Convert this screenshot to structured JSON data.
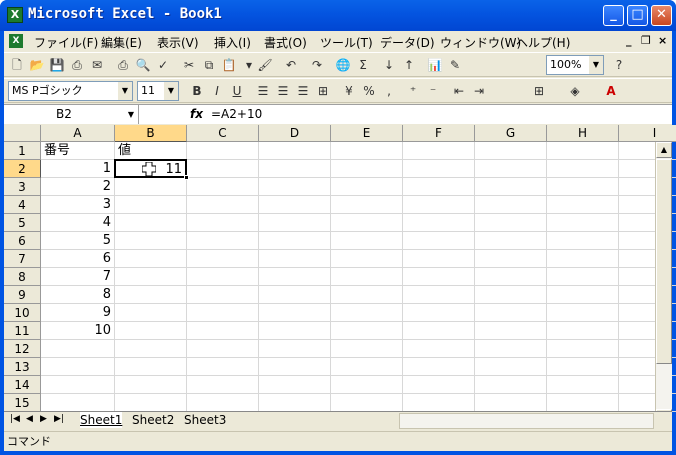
{
  "app": {
    "title": "Microsoft Excel - Book1",
    "icon_label": "X"
  },
  "window_buttons": {
    "minimize": "_",
    "maximize": "□",
    "close": "✕"
  },
  "menu": [
    {
      "label": "ファイル(F)"
    },
    {
      "label": "編集(E)"
    },
    {
      "label": "表示(V)"
    },
    {
      "label": "挿入(I)"
    },
    {
      "label": "書式(O)"
    },
    {
      "label": "ツール(T)"
    },
    {
      "label": "データ(D)"
    },
    {
      "label": "ウィンドウ(W)"
    },
    {
      "label": "ヘルプ(H)"
    }
  ],
  "mdi": {
    "minimize": "_",
    "restore": "❐",
    "close": "×"
  },
  "standard_toolbar": {
    "zoom": "100%"
  },
  "format_toolbar": {
    "font_name": "MS Pゴシック",
    "font_size": "11",
    "bold": "B",
    "italic": "I",
    "underline": "U",
    "percent": "%",
    "comma": ","
  },
  "formula_bar": {
    "name_box": "B2",
    "fx": "fx",
    "formula": "=A2+10"
  },
  "columns": [
    "A",
    "B",
    "C",
    "D",
    "E",
    "F",
    "G",
    "H",
    "I"
  ],
  "rows": [
    "1",
    "2",
    "3",
    "4",
    "5",
    "6",
    "7",
    "8",
    "9",
    "10",
    "11",
    "12",
    "13",
    "14",
    "15"
  ],
  "cells": {
    "A1": "番号",
    "B1": "値",
    "A2": "1",
    "B2": "11",
    "A3": "2",
    "A4": "3",
    "A5": "4",
    "A6": "5",
    "A7": "6",
    "A8": "7",
    "A9": "8",
    "A10": "9",
    "A11": "10"
  },
  "sheets": [
    "Sheet1",
    "Sheet2",
    "Sheet3"
  ],
  "active_sheet": "Sheet1",
  "status": "コマンド",
  "selection": {
    "cell": "B2",
    "column": "B",
    "row": "2"
  }
}
